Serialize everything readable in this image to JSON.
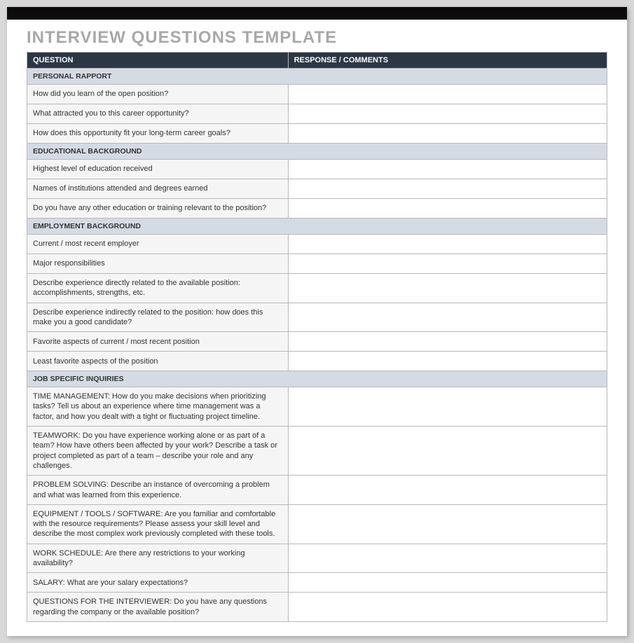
{
  "title": "INTERVIEW QUESTIONS TEMPLATE",
  "columns": {
    "question": "QUESTION",
    "response": "RESPONSE / COMMENTS"
  },
  "sections": [
    {
      "name": "PERSONAL RAPPORT",
      "rows": [
        {
          "q": "How did you learn of the open position?",
          "r": ""
        },
        {
          "q": "What attracted you to this career opportunity?",
          "r": ""
        },
        {
          "q": "How does this opportunity fit your long-term career goals?",
          "r": ""
        }
      ]
    },
    {
      "name": "EDUCATIONAL BACKGROUND",
      "rows": [
        {
          "q": "Highest level of education received",
          "r": ""
        },
        {
          "q": "Names of institutions attended and degrees earned",
          "r": ""
        },
        {
          "q": "Do you have any other education or training relevant to the position?",
          "r": ""
        }
      ]
    },
    {
      "name": "EMPLOYMENT BACKGROUND",
      "rows": [
        {
          "q": "Current / most recent employer",
          "r": ""
        },
        {
          "q": "Major responsibilities",
          "r": ""
        },
        {
          "q": "Describe experience directly related to the available position: accomplishments, strengths, etc.",
          "r": ""
        },
        {
          "q": "Describe experience indirectly related to the position: how does this make you a good candidate?",
          "r": ""
        },
        {
          "q": "Favorite aspects of current / most recent position",
          "r": ""
        },
        {
          "q": "Least favorite aspects of the position",
          "r": ""
        }
      ]
    },
    {
      "name": "JOB SPECIFIC INQUIRIES",
      "rows": [
        {
          "q": "TIME MANAGEMENT: How do you make decisions when prioritizing tasks? Tell us about an experience where time management was a factor, and how you dealt with a tight or fluctuating project timeline.",
          "r": ""
        },
        {
          "q": "TEAMWORK: Do you have experience working alone or as part of a team? How have others been affected by your work? Describe a task or project completed as part of a team – describe your role and any challenges.",
          "r": ""
        },
        {
          "q": "PROBLEM SOLVING: Describe an instance of overcoming a problem and what was learned from this experience.",
          "r": ""
        },
        {
          "q": "EQUIPMENT / TOOLS / SOFTWARE: Are you familiar and comfortable with the resource requirements? Please assess your skill level and describe the most complex work previously completed with these tools.",
          "r": ""
        },
        {
          "q": "WORK SCHEDULE: Are there any restrictions to your working availability?",
          "r": ""
        },
        {
          "q": "SALARY: What are your salary expectations?",
          "r": ""
        },
        {
          "q": "QUESTIONS FOR THE INTERVIEWER: Do you have any questions regarding the company or the available position?",
          "r": ""
        }
      ]
    }
  ]
}
